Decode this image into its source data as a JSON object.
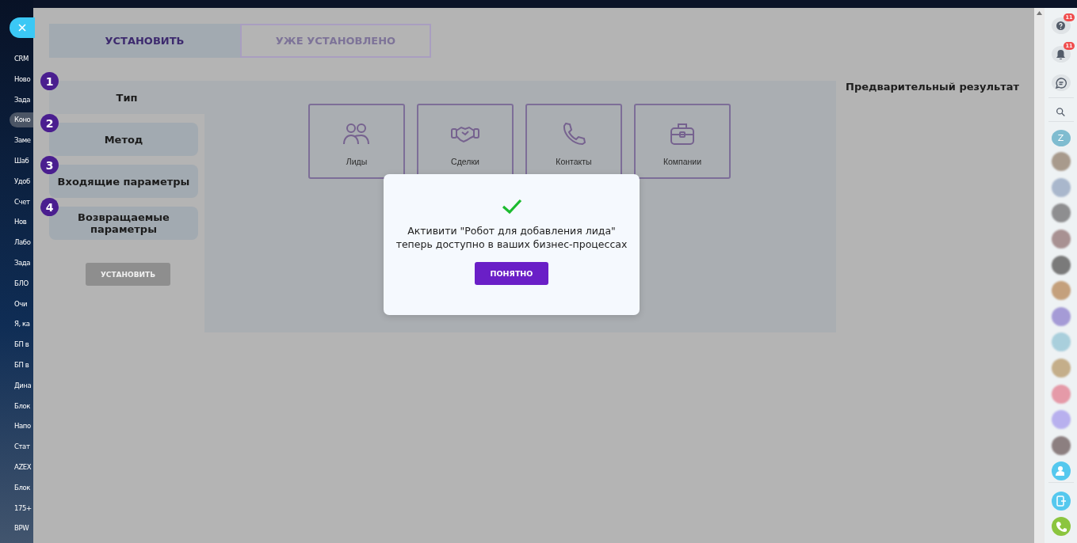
{
  "sidebar": {
    "items": [
      {
        "label": "CRM",
        "selected": false
      },
      {
        "label": "Ново",
        "selected": false
      },
      {
        "label": "Зада",
        "selected": false
      },
      {
        "label": "Коно",
        "selected": true
      },
      {
        "label": "Заме",
        "selected": false
      },
      {
        "label": "Шаб",
        "selected": false
      },
      {
        "label": "Удоб",
        "selected": false
      },
      {
        "label": "Счет",
        "selected": false
      },
      {
        "label": "Нов",
        "selected": false
      },
      {
        "label": "Лабо",
        "selected": false
      },
      {
        "label": "Зада",
        "selected": false
      },
      {
        "label": "БЛО",
        "selected": false
      },
      {
        "label": "Очи",
        "selected": false
      },
      {
        "label": "Я, ка",
        "selected": false
      },
      {
        "label": "БП в",
        "selected": false
      },
      {
        "label": "БП в",
        "selected": false
      },
      {
        "label": "Дина",
        "selected": false
      },
      {
        "label": "Блок",
        "selected": false
      },
      {
        "label": "Напо",
        "selected": false
      },
      {
        "label": "Стат",
        "selected": false
      },
      {
        "label": "AZEX",
        "selected": false
      },
      {
        "label": "Блок",
        "selected": false
      },
      {
        "label": "175+",
        "selected": false
      },
      {
        "label": "BPW",
        "selected": false
      }
    ]
  },
  "tabs": [
    {
      "label": "УСТАНОВИТЬ",
      "selected": true
    },
    {
      "label": "УЖЕ УСТАНОВЛЕНО",
      "selected": false
    }
  ],
  "steps": [
    {
      "number": "1",
      "label": "Тип",
      "selected": true
    },
    {
      "number": "2",
      "label": "Метод",
      "selected": false
    },
    {
      "number": "3",
      "label": "Входящие параметры",
      "selected": false
    },
    {
      "number": "4",
      "label": "Возвращаемые параметры",
      "selected": false
    }
  ],
  "install_button": {
    "label": "УСТАНОВИТЬ",
    "disabled": true
  },
  "entity_types": [
    {
      "kind": "people",
      "label": "Лиды"
    },
    {
      "kind": "handshake",
      "label": "Сделки"
    },
    {
      "kind": "phone",
      "label": "Контакты"
    },
    {
      "kind": "briefcase",
      "label": "Компании"
    }
  ],
  "preview_title": "Предварительный результат",
  "dialog": {
    "message": "Активити \"Робот для добавления лида\" теперь доступно в ваших бизнес-процессах",
    "button": "ПОНЯТНО"
  },
  "right_bar": {
    "help_badge": "11",
    "notifications_badge": "11",
    "user_initial": "Z"
  }
}
